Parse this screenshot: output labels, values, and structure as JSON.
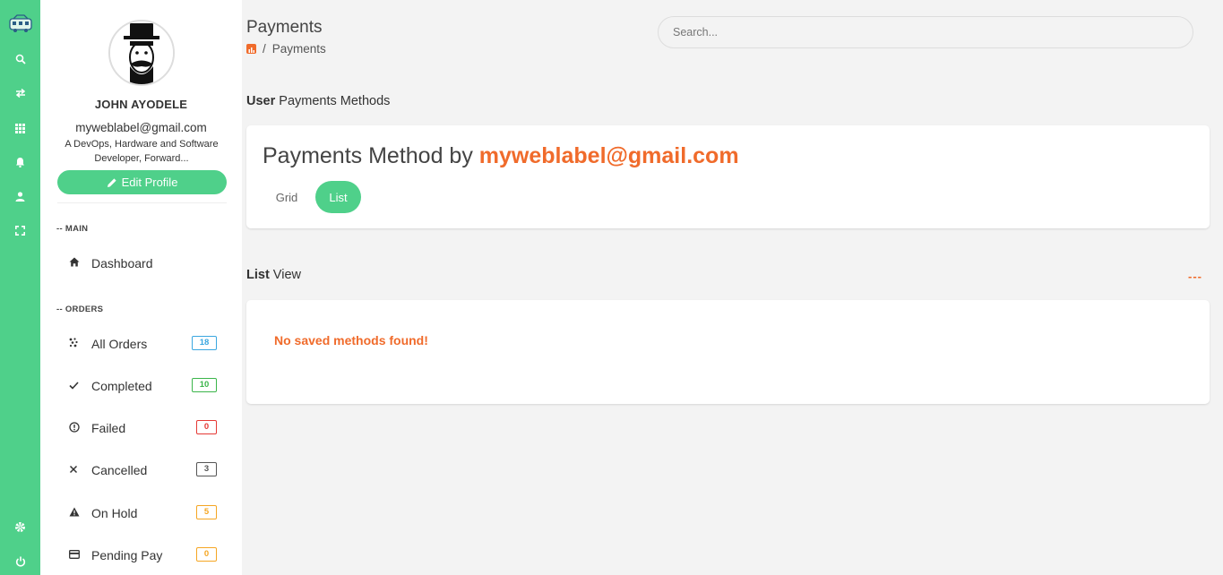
{
  "rail": {
    "icons": [
      "app-logo",
      "search-icon",
      "transfer-icon",
      "grid-icon",
      "bell-icon",
      "user-icon",
      "fullscreen-icon",
      "gear-icon",
      "power-icon"
    ]
  },
  "profile": {
    "name": "JOHN AYODELE",
    "email": "myweblabel@gmail.com",
    "bio": "A DevOps, Hardware and Software Developer, Forward...",
    "edit_label": "Edit Profile"
  },
  "sections": {
    "main": "-- MAIN",
    "orders": "-- ORDERS"
  },
  "nav_main": [
    {
      "label": "Dashboard",
      "icon": "home-icon"
    }
  ],
  "nav_orders": [
    {
      "label": "All Orders",
      "icon": "orders-icon",
      "count": "18",
      "color": "#3ba7e0"
    },
    {
      "label": "Completed",
      "icon": "check-icon",
      "count": "10",
      "color": "#3bb54a"
    },
    {
      "label": "Failed",
      "icon": "alert-circle-icon",
      "count": "0",
      "color": "#e53935"
    },
    {
      "label": "Cancelled",
      "icon": "close-icon",
      "count": "3",
      "color": "#555555"
    },
    {
      "label": "On Hold",
      "icon": "warning-icon",
      "count": "5",
      "color": "#f5a623"
    },
    {
      "label": "Pending Pay",
      "icon": "card-icon",
      "count": "0",
      "color": "#f5a623"
    }
  ],
  "header": {
    "title": "Payments",
    "breadcrumb_sep": "/",
    "breadcrumb_current": "Payments",
    "search_placeholder": "Search..."
  },
  "methods": {
    "heading_bold": "User",
    "heading_rest": " Payments Methods",
    "card_title": "Payments Method by ",
    "card_email": "myweblabel@gmail.com",
    "tabs": [
      "Grid",
      "List"
    ],
    "active_tab": "List"
  },
  "list_view": {
    "heading_bold": "List",
    "heading_rest": " View",
    "more": "---",
    "empty_message": "No saved methods found!"
  },
  "colors": {
    "accent_green": "#4fd08a",
    "accent_orange": "#f06b2b"
  }
}
